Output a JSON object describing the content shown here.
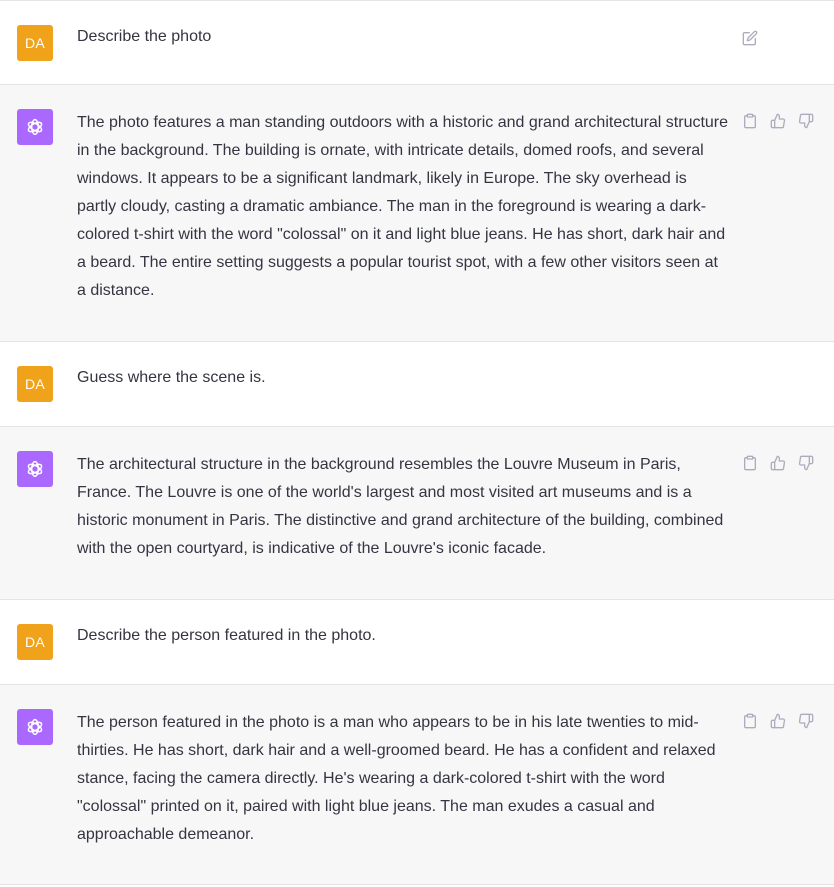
{
  "colors": {
    "user_avatar": "#f0a21b",
    "assistant_avatar": "#ab68ff",
    "assistant_bg": "#f7f7f8",
    "text": "#343541",
    "icon": "#acacbe"
  },
  "icons": {
    "edit": "pencil-square-icon",
    "copy": "clipboard-icon",
    "upvote": "thumbs-up-icon",
    "downvote": "thumbs-down-icon",
    "assistant_logo": "openai-logo-icon"
  },
  "messages": [
    {
      "role": "user",
      "avatar": "DA",
      "text": "Describe the photo"
    },
    {
      "role": "assistant",
      "text": "The photo features a man standing outdoors with a historic and grand architectural structure in the background. The building is ornate, with intricate details, domed roofs, and several windows. It appears to be a significant landmark, likely in Europe. The sky overhead is partly cloudy, casting a dramatic ambiance. The man in the foreground is wearing a dark-colored t-shirt with the word \"colossal\" on it and light blue jeans. He has short, dark hair and a beard. The entire setting suggests a popular tourist spot, with a few other visitors seen at a distance."
    },
    {
      "role": "user",
      "avatar": "DA",
      "text": "Guess where the scene is."
    },
    {
      "role": "assistant",
      "text": "The architectural structure in the background resembles the Louvre Museum in Paris, France. The Louvre is one of the world's largest and most visited art museums and is a historic monument in Paris. The distinctive and grand architecture of the building, combined with the open courtyard, is indicative of the Louvre's iconic facade."
    },
    {
      "role": "user",
      "avatar": "DA",
      "text": "Describe the person featured in the photo."
    },
    {
      "role": "assistant",
      "text": "The person featured in the photo is a man who appears to be in his late twenties to mid-thirties. He has short, dark hair and a well-groomed beard. He has a confident and relaxed stance, facing the camera directly. He's wearing a dark-colored t-shirt with the word \"colossal\" printed on it, paired with light blue jeans. The man exudes a casual and approachable demeanor."
    }
  ]
}
